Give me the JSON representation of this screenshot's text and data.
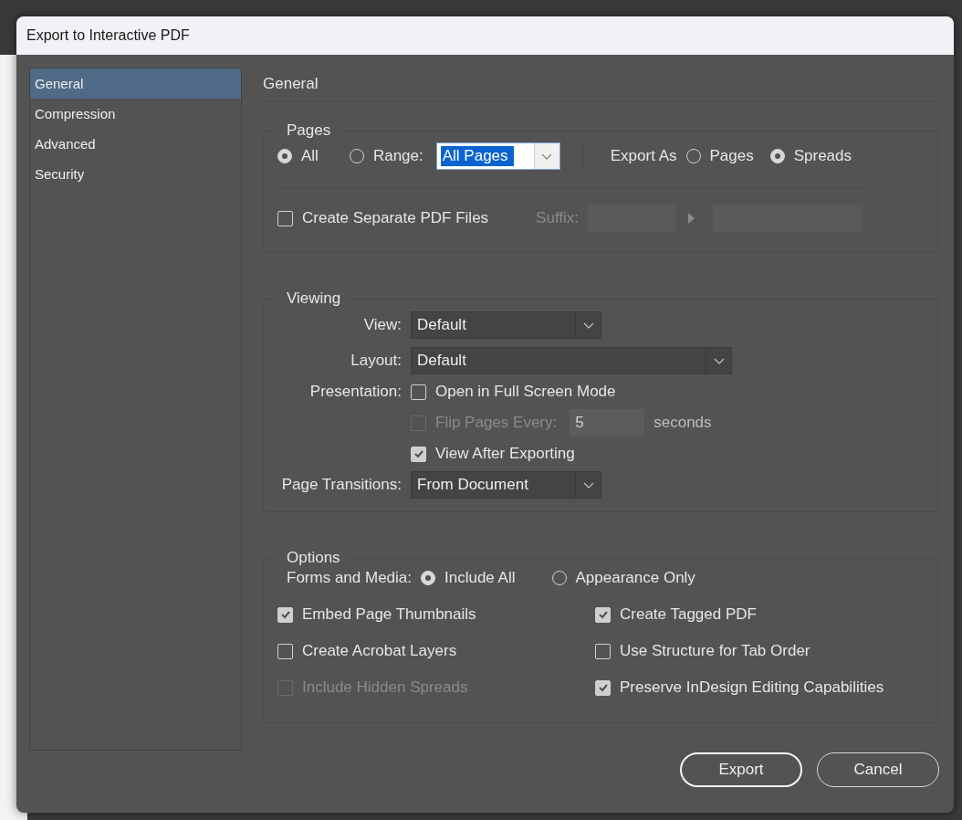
{
  "window": {
    "title": "Export to Interactive PDF"
  },
  "sidebar": {
    "items": [
      {
        "label": "General",
        "selected": true
      },
      {
        "label": "Compression",
        "selected": false
      },
      {
        "label": "Advanced",
        "selected": false
      },
      {
        "label": "Security",
        "selected": false
      }
    ]
  },
  "heading": "General",
  "pages": {
    "title": "Pages",
    "scope": [
      {
        "label": "All",
        "selected": true
      },
      {
        "label": "Range:",
        "selected": false
      }
    ],
    "range_field": {
      "value": "All Pages"
    },
    "export_as": {
      "label": "Export As",
      "options": [
        {
          "label": "Pages",
          "selected": false
        },
        {
          "label": "Spreads",
          "selected": true
        }
      ]
    },
    "separate_files": {
      "label": "Create Separate PDF Files",
      "checked": false
    },
    "suffix": {
      "label": "Suffix:",
      "disabled": true
    }
  },
  "viewing": {
    "title": "Viewing",
    "view": {
      "label": "View:",
      "value": "Default"
    },
    "layout": {
      "label": "Layout:",
      "value": "Default"
    },
    "presentation_label": "Presentation:",
    "full_screen": {
      "label": "Open in Full Screen Mode",
      "checked": false,
      "disabled": false
    },
    "flip_pages": {
      "label": "Flip Pages Every:",
      "checked": false,
      "disabled": true,
      "value": "5",
      "unit": "seconds"
    },
    "view_after": {
      "label": "View After Exporting",
      "checked": true,
      "disabled": false
    },
    "transitions": {
      "label": "Page Transitions:",
      "value": "From Document"
    }
  },
  "options": {
    "title": "Options",
    "forms_label": "Forms and Media:",
    "forms": [
      {
        "label": "Include All",
        "selected": true
      },
      {
        "label": "Appearance Only",
        "selected": false
      }
    ],
    "checks": [
      {
        "label": "Embed Page Thumbnails",
        "checked": true,
        "disabled": false
      },
      {
        "label": "Create Tagged PDF",
        "checked": true,
        "disabled": false
      },
      {
        "label": "Create Acrobat Layers",
        "checked": false,
        "disabled": false
      },
      {
        "label": "Use Structure for Tab Order",
        "checked": false,
        "disabled": false
      },
      {
        "label": "Include Hidden Spreads",
        "checked": false,
        "disabled": true
      },
      {
        "label": "Preserve InDesign Editing Capabilities",
        "checked": true,
        "disabled": false
      }
    ]
  },
  "buttons": [
    {
      "label": "Export",
      "default": true
    },
    {
      "label": "Cancel",
      "default": false
    }
  ]
}
